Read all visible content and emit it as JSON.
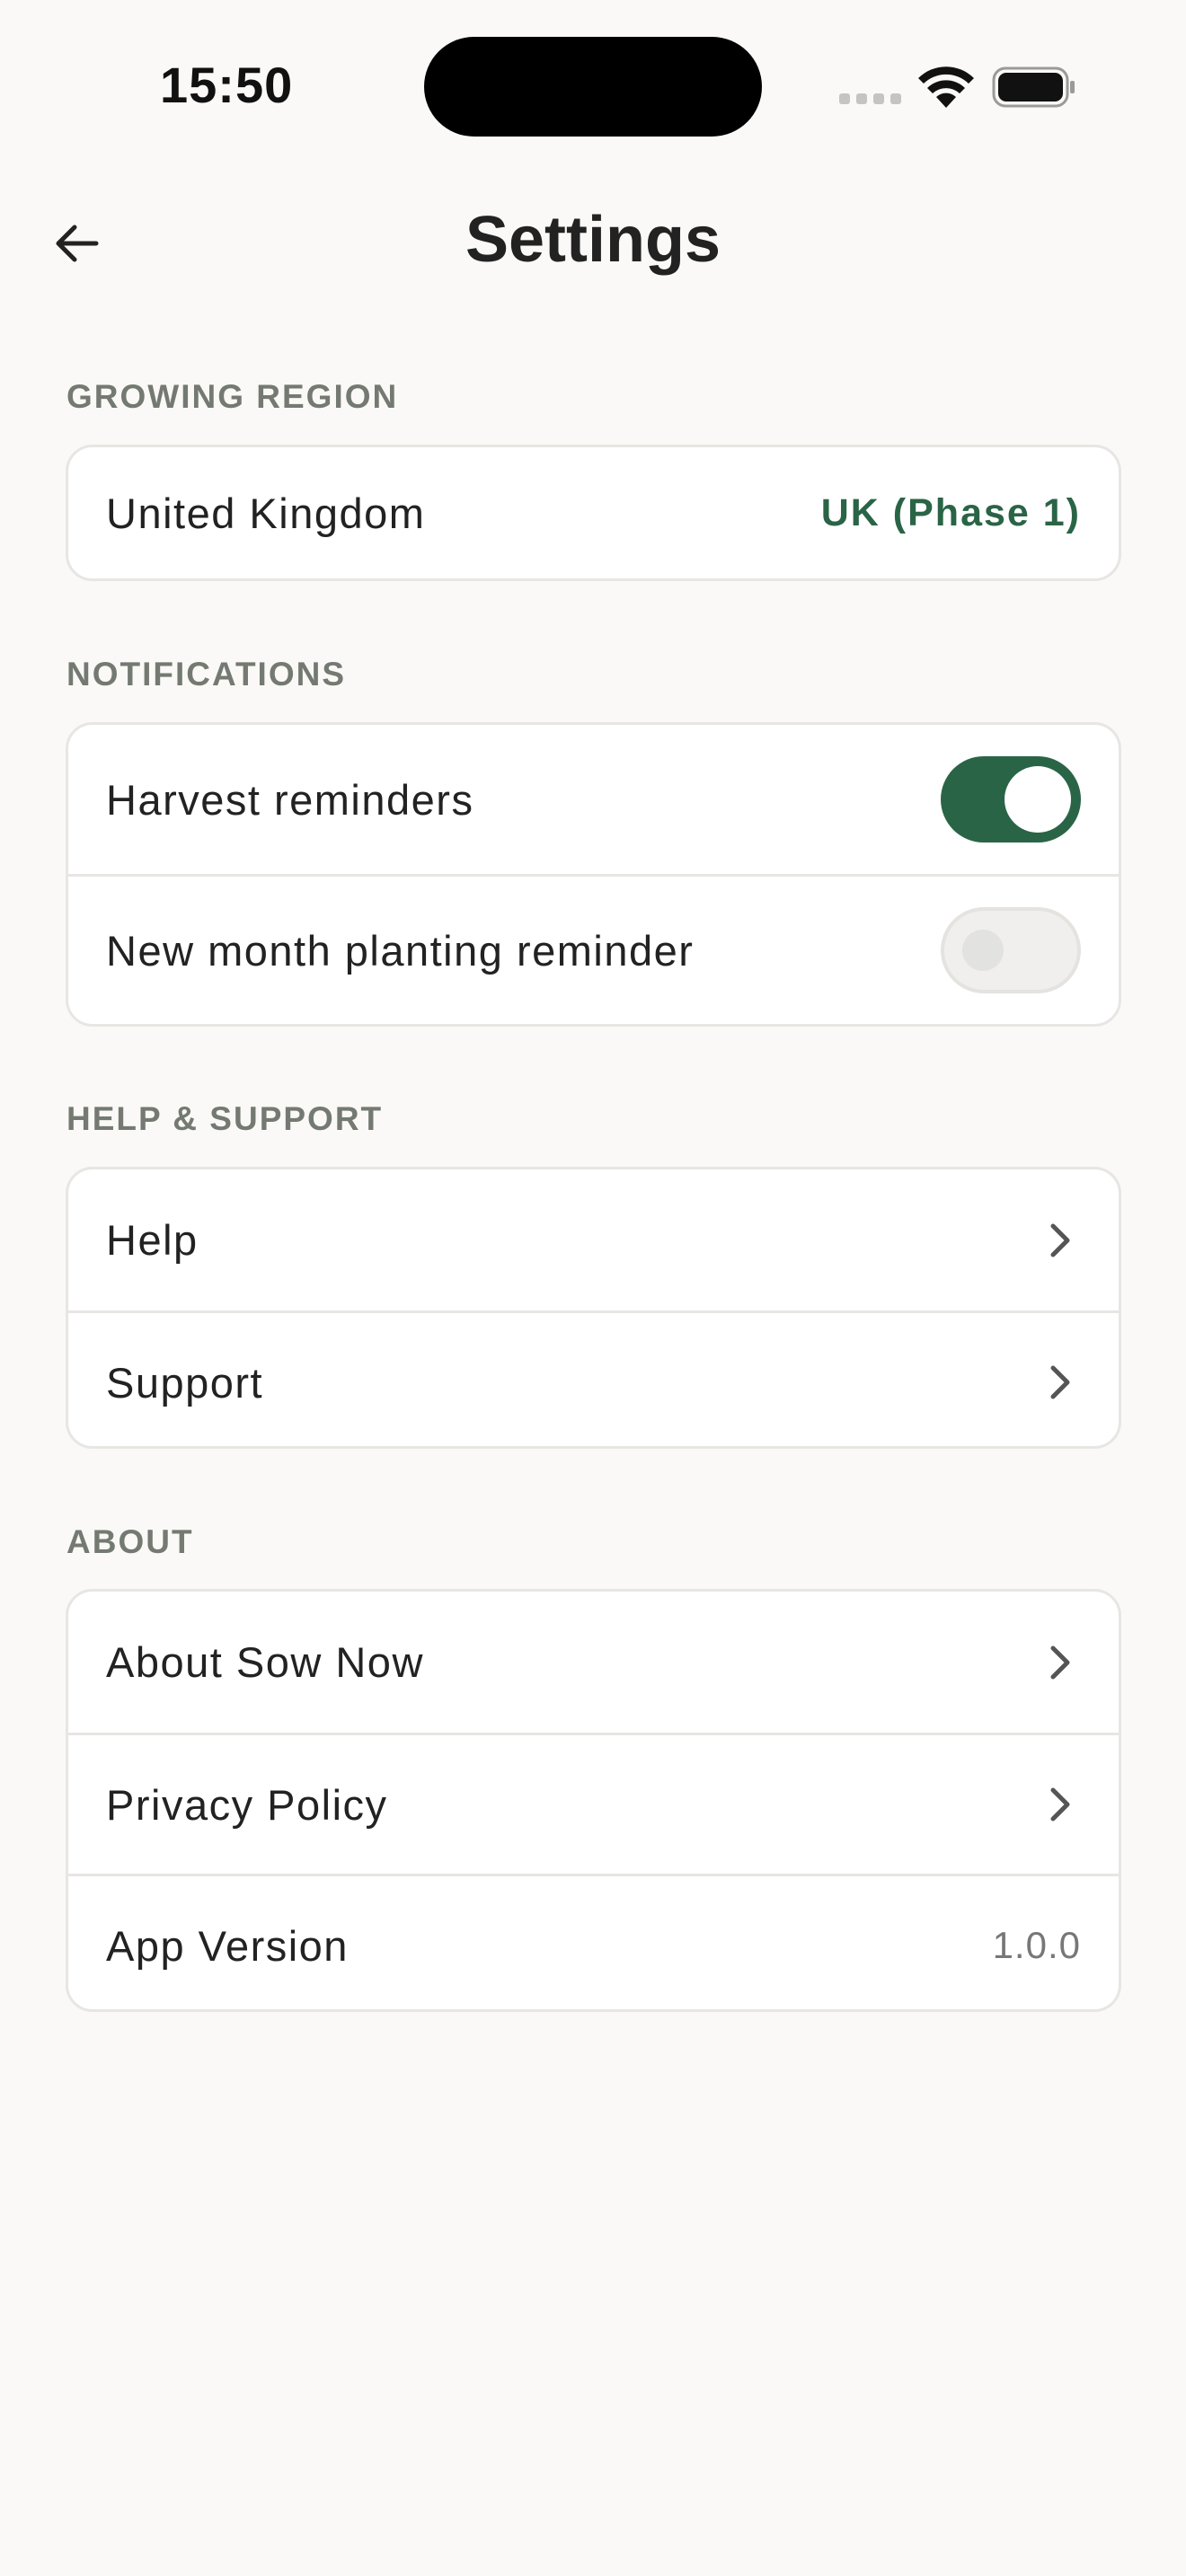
{
  "status_bar": {
    "time": "15:50"
  },
  "header": {
    "title": "Settings"
  },
  "sections": {
    "region": {
      "label": "GROWING REGION",
      "rows": [
        {
          "label": "United Kingdom",
          "value": "UK (Phase 1)"
        }
      ]
    },
    "notifications": {
      "label": "NOTIFICATIONS",
      "rows": [
        {
          "label": "Harvest reminders",
          "toggle": "on"
        },
        {
          "label": "New month planting reminder",
          "toggle": "off"
        }
      ]
    },
    "help": {
      "label": "HELP & SUPPORT",
      "rows": [
        {
          "label": "Help"
        },
        {
          "label": "Support"
        }
      ]
    },
    "about": {
      "label": "ABOUT",
      "rows": [
        {
          "label": "About Sow Now"
        },
        {
          "label": "Privacy Policy"
        },
        {
          "label": "App Version",
          "value": "1.0.0"
        }
      ]
    }
  },
  "icons": {
    "back": "arrow-left-icon",
    "chevron": "chevron-right-icon",
    "wifi": "wifi-icon",
    "battery": "battery-icon",
    "signal": "cellular-signal-icon"
  },
  "colors": {
    "accent": "#2a6446",
    "background": "#faf9f7",
    "section_label": "#747a72",
    "card_border": "#e7e6e3"
  }
}
